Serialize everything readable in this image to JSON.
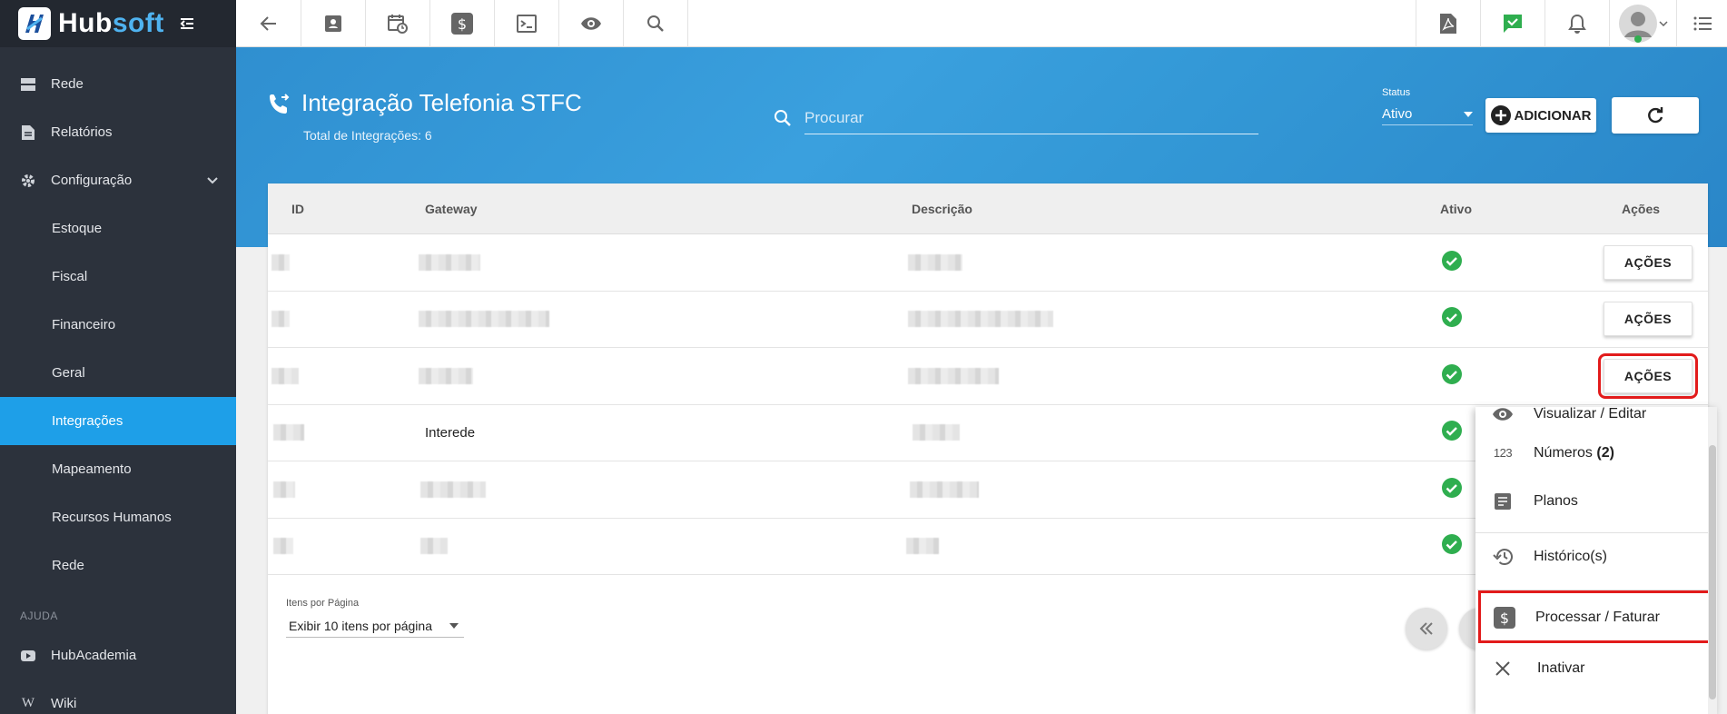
{
  "app": {
    "logo_hub": "Hub",
    "logo_soft": "soft"
  },
  "sidebar": {
    "items": [
      {
        "label": "Rede",
        "icon": "server-icon"
      },
      {
        "label": "Relatórios",
        "icon": "document-icon"
      },
      {
        "label": "Configuração",
        "icon": "gear-icon"
      }
    ],
    "sub_items": [
      "Estoque",
      "Fiscal",
      "Financeiro",
      "Geral",
      "Integrações",
      "Mapeamento",
      "Recursos Humanos",
      "Rede"
    ],
    "section_help": "AJUDA",
    "help_items": [
      {
        "label": "HubAcademia",
        "icon": "youtube-icon"
      },
      {
        "label": "Wiki",
        "icon": "wikipedia-icon"
      }
    ]
  },
  "header": {
    "title": "Integração Telefonia STFC",
    "subtitle": "Total de Integrações: 6",
    "search_placeholder": "Procurar",
    "status_label": "Status",
    "status_value": "Ativo",
    "add_label": "ADICIONAR"
  },
  "table": {
    "columns": [
      "ID",
      "Gateway",
      "Descrição",
      "Ativo",
      "Ações"
    ],
    "rows": [
      {
        "gateway": "",
        "action_label": "AÇÕES"
      },
      {
        "gateway": "",
        "action_label": "AÇÕES"
      },
      {
        "gateway": "",
        "action_label": "AÇÕES"
      },
      {
        "gateway": "Interede"
      },
      {
        "gateway": ""
      },
      {
        "gateway": ""
      }
    ]
  },
  "pagination": {
    "label": "Itens por Página",
    "value": "Exibir 10 itens por página"
  },
  "menu": {
    "items": [
      {
        "label": "Visualizar / Editar",
        "icon": "eye-icon"
      },
      {
        "label": "Números",
        "count": "(2)",
        "icon": "numbers-icon"
      },
      {
        "label": "Planos",
        "icon": "list-doc-icon"
      },
      {
        "label": "Histórico(s)",
        "icon": "history-icon"
      },
      {
        "label": "Processar / Faturar",
        "icon": "dollar-icon"
      },
      {
        "label": "Inativar",
        "icon": "close-icon"
      }
    ]
  },
  "colors": {
    "accent": "#1e9fe8",
    "sidebar": "#2c323c",
    "hero": "#3398d6",
    "success": "#2fae4f",
    "highlight": "#e21b1b"
  }
}
